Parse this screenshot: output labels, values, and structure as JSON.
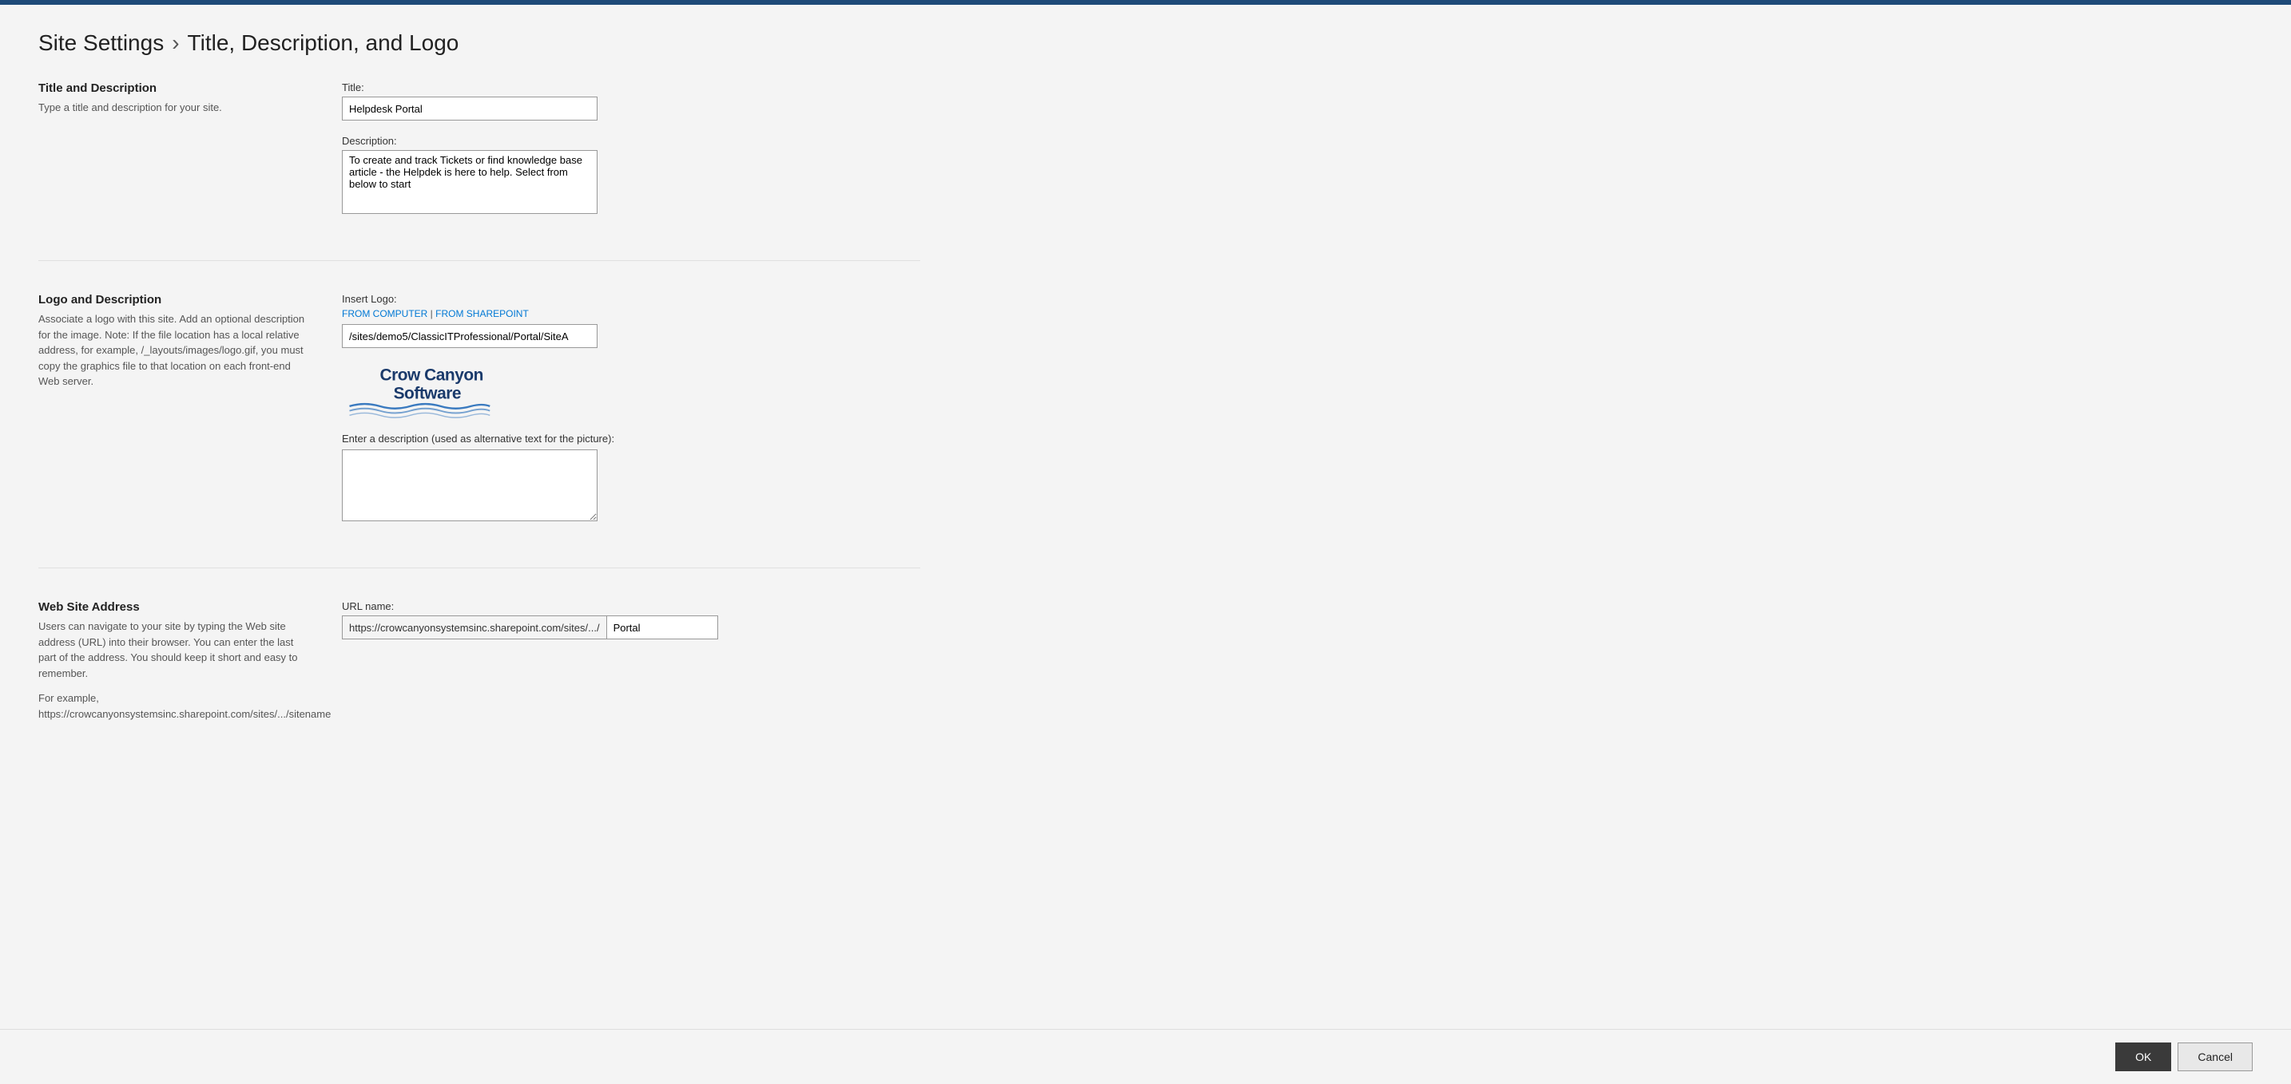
{
  "topBar": {},
  "page": {
    "breadcrumb_part1": "Site Settings",
    "breadcrumb_sep": "›",
    "breadcrumb_part2": "Title, Description, and Logo"
  },
  "titleSection": {
    "heading": "Title and Description",
    "desc": "Type a title and description for your site.",
    "title_label": "Title:",
    "title_value": "Helpdesk Portal",
    "desc_label": "Description:",
    "desc_value": "To create and track Tickets or find knowledge base article - the Helpdek is here to help. Select from below to start"
  },
  "logoSection": {
    "heading": "Logo and Description",
    "desc": "Associate a logo with this site. Add an optional description for the image. Note: If the file location has a local relative address, for example, /_layouts/images/logo.gif, you must copy the graphics file to that location on each front-end Web server.",
    "insert_logo_label": "Insert Logo:",
    "from_computer": "FROM COMPUTER",
    "separator": " | ",
    "from_sharepoint": "FROM SHAREPOINT",
    "logo_url_value": "/sites/demo5/ClassicITProfessional/Portal/SiteA",
    "alt_text_label": "Enter a description (used as alternative text for the picture):",
    "alt_text_value": "",
    "logo_text_line1": "Crow Canyon",
    "logo_text_line2": "Software"
  },
  "websiteSection": {
    "heading": "Web Site Address",
    "desc1": "Users can navigate to your site by typing the Web site address (URL) into their browser. You can enter the last part of the address. You should keep it short and easy to remember.",
    "desc2": "For example, https://crowcanyonsystemsinc.sharepoint.com/sites/.../sitename",
    "url_name_label": "URL name:",
    "url_prefix": "https://crowcanyonsystemsinc.sharepoint.com/sites/.../",
    "url_suffix_value": "Portal"
  },
  "footer": {
    "ok_label": "OK",
    "cancel_label": "Cancel"
  }
}
